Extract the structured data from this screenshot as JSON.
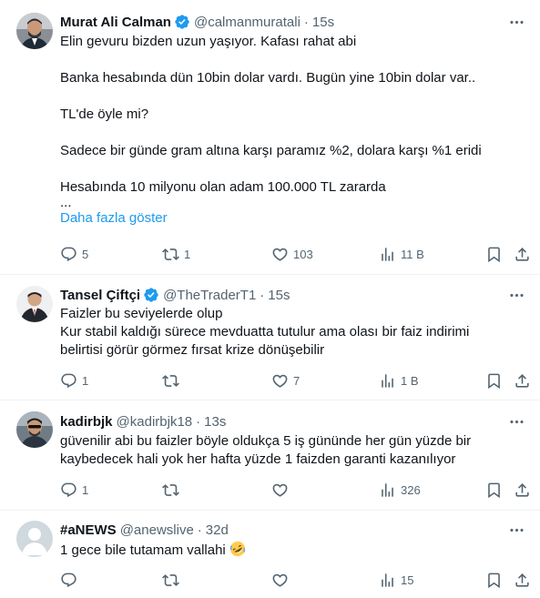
{
  "tweets": [
    {
      "name": "Murat Ali Calman",
      "handle": "@calmanmuratali",
      "time": "15s",
      "verified": true,
      "lines": [
        "Elin gevuru bizden uzun yaşıyor. Kafası rahat abi",
        "",
        "Banka hesabında dün 10bin dolar vardı. Bugün yine 10bin dolar var..",
        "",
        "TL'de öyle mi?",
        "",
        "Sadece bir günde gram altına karşı paramız %2, dolara karşı %1 eridi",
        "",
        "Hesabında 10 milyonu olan adam 100.000 TL zararda",
        "..."
      ],
      "show_more": "Daha fazla göster",
      "replies": "5",
      "retweets": "1",
      "likes": "103",
      "views": "11 B"
    },
    {
      "name": "Tansel Çiftçi",
      "handle": "@TheTraderT1",
      "time": "15s",
      "verified": true,
      "lines": [
        "Faizler bu seviyelerde olup",
        "Kur stabil kaldığı sürece mevduatta tutulur ama olası bir faiz indirimi",
        "belirtisi görür görmez fırsat krize dönüşebilir"
      ],
      "replies": "1",
      "retweets": "",
      "likes": "7",
      "views": "1 B"
    },
    {
      "name": "kadirbjk",
      "handle": "@kadirbjk18",
      "time": "13s",
      "verified": false,
      "lines": [
        "güvenilir abi bu faizler böyle oldukça 5 iş gününde her gün yüzde bir",
        "kaybedecek hali yok her hafta yüzde 1 faizden garanti kazanılıyor"
      ],
      "replies": "1",
      "retweets": "",
      "likes": "",
      "views": "326"
    },
    {
      "name": "#aNEWS",
      "handle": "@anewslive",
      "time": "32d",
      "verified": false,
      "lines": [
        "1 gece bile tutamam vallahi"
      ],
      "emoji": "rolling-on-floor-laughing",
      "replies": "",
      "retweets": "",
      "likes": "",
      "views": "15"
    }
  ],
  "colors": {
    "text": "#0f1419",
    "secondary": "#536471",
    "link": "#1d9bf0",
    "verified": "#1d9bf0",
    "divider": "#eff3f4"
  },
  "icons": [
    "reply-icon",
    "retweet-icon",
    "like-icon",
    "views-icon",
    "bookmark-icon",
    "share-icon",
    "more-icon",
    "verified-icon"
  ]
}
